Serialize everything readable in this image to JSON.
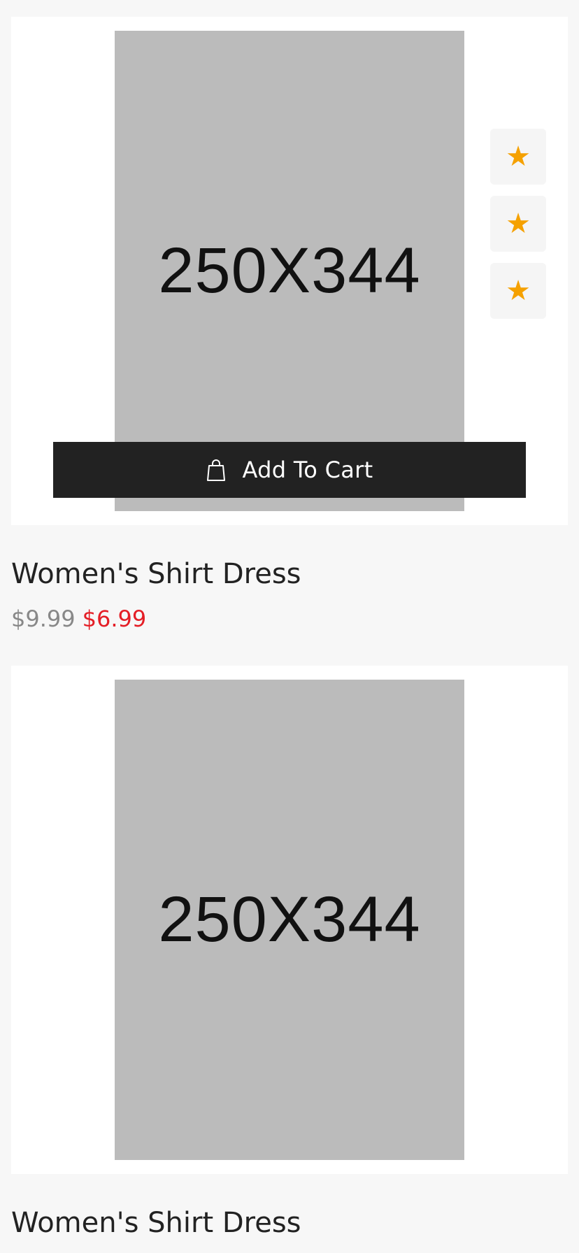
{
  "products": [
    {
      "image_label": "250X344",
      "title": "Women's Shirt Dress",
      "old_price": "$9.99",
      "new_price": "$6.99",
      "add_to_cart_label": "Add To Cart",
      "action_icons": [
        "star-icon",
        "star-icon",
        "star-icon"
      ]
    },
    {
      "image_label": "250X344",
      "title": "Women's Shirt Dress"
    }
  ],
  "colors": {
    "page_background": "#f7f7f7",
    "card_background": "#ffffff",
    "placeholder": "#bbbbbb",
    "button_dark": "#222222",
    "star": "#f5a100",
    "old_price": "#888888",
    "sale_price": "#e41e26"
  }
}
